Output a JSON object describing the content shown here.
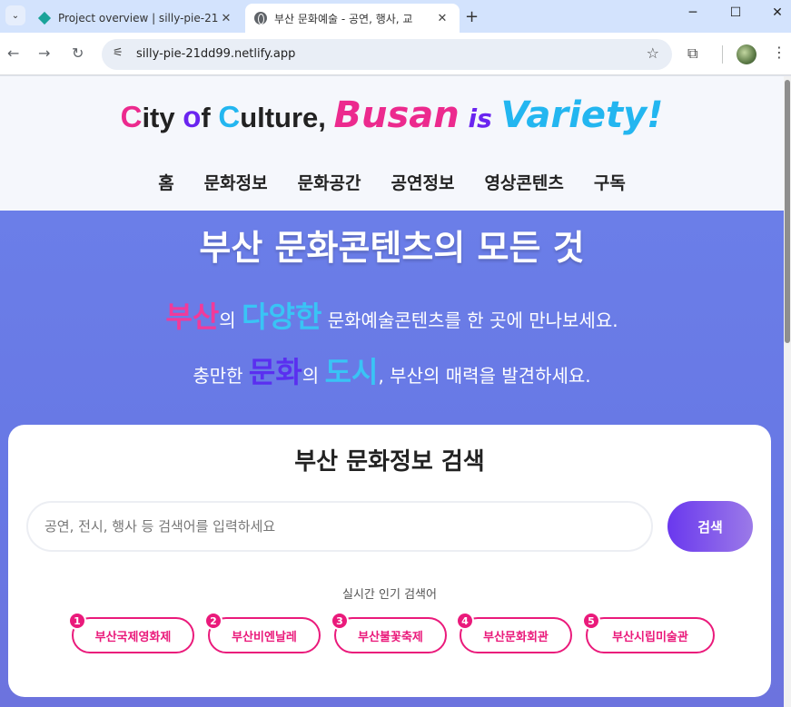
{
  "browser": {
    "tabs": [
      {
        "title": "Project overview | silly-pie-21d",
        "active": false
      },
      {
        "title": "부산 문화예술 - 공연, 행사, 교",
        "active": true
      }
    ],
    "new_tab": "+",
    "window_controls": {
      "minimize": "─",
      "maximize": "☐",
      "close": "✕"
    },
    "url": "silly-pie-21dd99.netlify.app"
  },
  "header": {
    "logo": {
      "c1": "C",
      "w1": "ity ",
      "o": "o",
      "w2": "f ",
      "c2": "C",
      "w3": "ulture, ",
      "busan": "Busan",
      "is": " is ",
      "variety": "Variety!"
    },
    "nav": [
      "홈",
      "문화정보",
      "문화공간",
      "공연정보",
      "영상콘텐츠",
      "구독"
    ]
  },
  "hero": {
    "title": "부산 문화콘텐츠의 모든 것",
    "line1": {
      "w1": "부산",
      "w2": "의 ",
      "w3": "다양한",
      "w4": " 문화예술콘텐츠를 한 곳에 만나보세요."
    },
    "line2": {
      "w1": "충만한 ",
      "w2": "문화",
      "w3": "의 ",
      "w4": "도시",
      "w5": ", 부산의 매력을 발견하세요."
    }
  },
  "search": {
    "title": "부산 문화정보 검색",
    "placeholder": "공연, 전시, 행사 등 검색어를 입력하세요",
    "value": "",
    "button": "검색",
    "popular_label": "실시간 인기 검색어",
    "popular": [
      {
        "rank": "1",
        "label": "부산국제영화제"
      },
      {
        "rank": "2",
        "label": "부산비엔날레"
      },
      {
        "rank": "3",
        "label": "부산불꽃축제"
      },
      {
        "rank": "4",
        "label": "부산문화회관"
      },
      {
        "rank": "5",
        "label": "부산시립미술관"
      }
    ]
  },
  "colors": {
    "accent_pink": "#ea1a7b",
    "hero_bg": "#6777e4",
    "logo_pink": "#ec2a8e",
    "logo_cyan": "#23b6f0",
    "logo_violet": "#6a24f0"
  }
}
